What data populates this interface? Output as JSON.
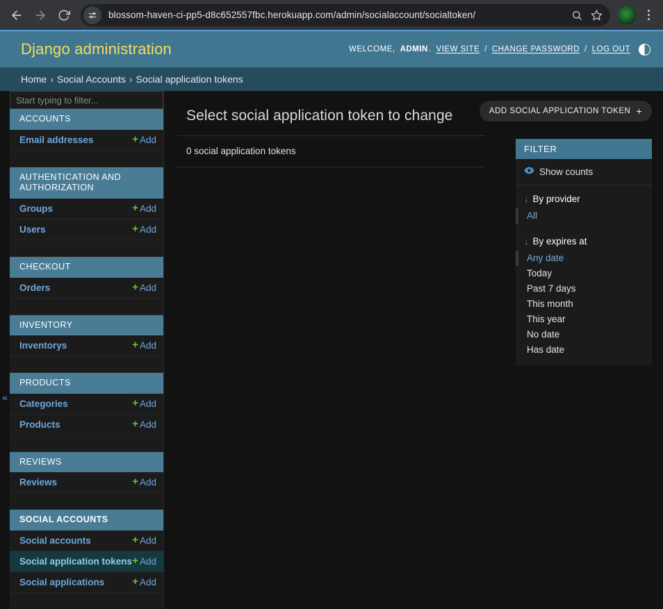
{
  "browser": {
    "url": "blossom-haven-ci-pp5-d8c652557fbc.herokuapp.com/admin/socialaccount/socialtoken/",
    "back_icon": "back-arrow-icon",
    "forward_icon": "forward-arrow-icon",
    "reload_icon": "reload-icon",
    "site_info_icon": "site-settings-icon",
    "search_icon": "search-icon",
    "bookmark_icon": "bookmark-star-icon",
    "profile_icon": "profile-avatar-icon",
    "menu_icon": "three-dot-menu-icon"
  },
  "header": {
    "site_title": "Django administration",
    "welcome_prefix": "WELCOME,",
    "user_name": "ADMIN",
    "period": ".",
    "view_site": "VIEW SITE",
    "sep1": "/",
    "change_password": "CHANGE PASSWORD",
    "sep2": "/",
    "log_out": "LOG OUT",
    "theme_toggle_icon": "theme-toggle-icon",
    "brand_color": "#417690",
    "title_color": "#f5dd5d"
  },
  "breadcrumbs": {
    "items": [
      "Home",
      "Social Accounts",
      "Social application tokens"
    ],
    "separator": "›"
  },
  "sidebar": {
    "filter_placeholder": "Start typing to filter...",
    "filter_value": "",
    "add_label": "Add",
    "plus_glyph": "+",
    "collapse_glyph": "«",
    "apps": [
      {
        "name": "ACCOUNTS",
        "current": false,
        "models": [
          {
            "label": "Email addresses",
            "current": false
          }
        ]
      },
      {
        "name": "AUTHENTICATION AND AUTHORIZATION",
        "current": false,
        "models": [
          {
            "label": "Groups",
            "current": false
          },
          {
            "label": "Users",
            "current": false
          }
        ]
      },
      {
        "name": "CHECKOUT",
        "current": false,
        "models": [
          {
            "label": "Orders",
            "current": false
          }
        ]
      },
      {
        "name": "INVENTORY",
        "current": false,
        "models": [
          {
            "label": "Inventorys",
            "current": false
          }
        ]
      },
      {
        "name": "PRODUCTS",
        "current": false,
        "models": [
          {
            "label": "Categories",
            "current": false
          },
          {
            "label": "Products",
            "current": false
          }
        ]
      },
      {
        "name": "REVIEWS",
        "current": false,
        "models": [
          {
            "label": "Reviews",
            "current": false
          }
        ]
      },
      {
        "name": "SOCIAL ACCOUNTS",
        "current": true,
        "models": [
          {
            "label": "Social accounts",
            "current": false
          },
          {
            "label": "Social application tokens",
            "current": true
          },
          {
            "label": "Social applications",
            "current": false
          }
        ]
      }
    ]
  },
  "main": {
    "title": "Select social application token to change",
    "result_count": "0 social application tokens",
    "add_button_label": "ADD SOCIAL APPLICATION TOKEN",
    "add_button_plus": "+"
  },
  "filter_panel": {
    "title": "FILTER",
    "show_counts_label": "Show counts",
    "show_counts_icon": "eye-icon",
    "arrow_glyph": "↓",
    "groups": [
      {
        "heading": "By provider",
        "choices": [
          {
            "label": "All",
            "selected": true
          }
        ]
      },
      {
        "heading": "By expires at",
        "choices": [
          {
            "label": "Any date",
            "selected": true
          },
          {
            "label": "Today",
            "selected": false
          },
          {
            "label": "Past 7 days",
            "selected": false
          },
          {
            "label": "This month",
            "selected": false
          },
          {
            "label": "This year",
            "selected": false
          },
          {
            "label": "No date",
            "selected": false
          },
          {
            "label": "Has date",
            "selected": false
          }
        ]
      }
    ]
  }
}
